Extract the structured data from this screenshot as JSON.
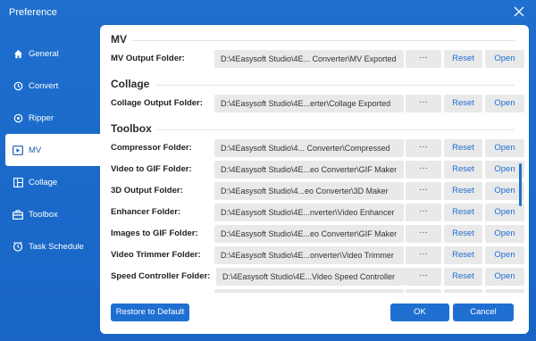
{
  "window": {
    "title": "Preference"
  },
  "sidebar": {
    "items": [
      {
        "label": "General",
        "icon": "home-icon",
        "active": false
      },
      {
        "label": "Convert",
        "icon": "convert-icon",
        "active": false
      },
      {
        "label": "Ripper",
        "icon": "ripper-icon",
        "active": false
      },
      {
        "label": "MV",
        "icon": "mv-icon",
        "active": true
      },
      {
        "label": "Collage",
        "icon": "collage-icon",
        "active": false
      },
      {
        "label": "Toolbox",
        "icon": "toolbox-icon",
        "active": false
      },
      {
        "label": "Task Schedule",
        "icon": "clock-icon",
        "active": false
      }
    ]
  },
  "sections": {
    "mv": "MV",
    "collage": "Collage",
    "toolbox": "Toolbox"
  },
  "buttons": {
    "dots": "···",
    "reset": "Reset",
    "open": "Open"
  },
  "rows": [
    {
      "label": "MV Output Folder:",
      "path": "D:\\4Easysoft Studio\\4E... Converter\\MV Exported"
    },
    {
      "label": "Collage Output Folder:",
      "path": "D:\\4Easysoft Studio\\4E...erter\\Collage Exported"
    },
    {
      "label": "Compressor Folder:",
      "path": "D:\\4Easysoft Studio\\4... Converter\\Compressed"
    },
    {
      "label": "Video to GIF Folder:",
      "path": "D:\\4Easysoft Studio\\4E...eo Converter\\GIF Maker"
    },
    {
      "label": "3D Output Folder:",
      "path": "D:\\4Easysoft Studio\\4...eo Converter\\3D Maker"
    },
    {
      "label": "Enhancer Folder:",
      "path": "D:\\4Easysoft Studio\\4E...nverter\\Video Enhancer"
    },
    {
      "label": "Images to GIF Folder:",
      "path": "D:\\4Easysoft Studio\\4E...eo Converter\\GIF Maker"
    },
    {
      "label": "Video Trimmer Folder:",
      "path": "D:\\4Easysoft Studio\\4E...onverter\\Video Trimmer"
    },
    {
      "label": "Speed Controller Folder:",
      "path": "D:\\4Easysoft Studio\\4E...Video Speed Controller"
    }
  ],
  "footer": {
    "restore": "Restore to Default",
    "ok": "OK",
    "cancel": "Cancel"
  },
  "colors": {
    "accent": "#1f6fd1",
    "sidebar_bg": "#1e6fce"
  }
}
